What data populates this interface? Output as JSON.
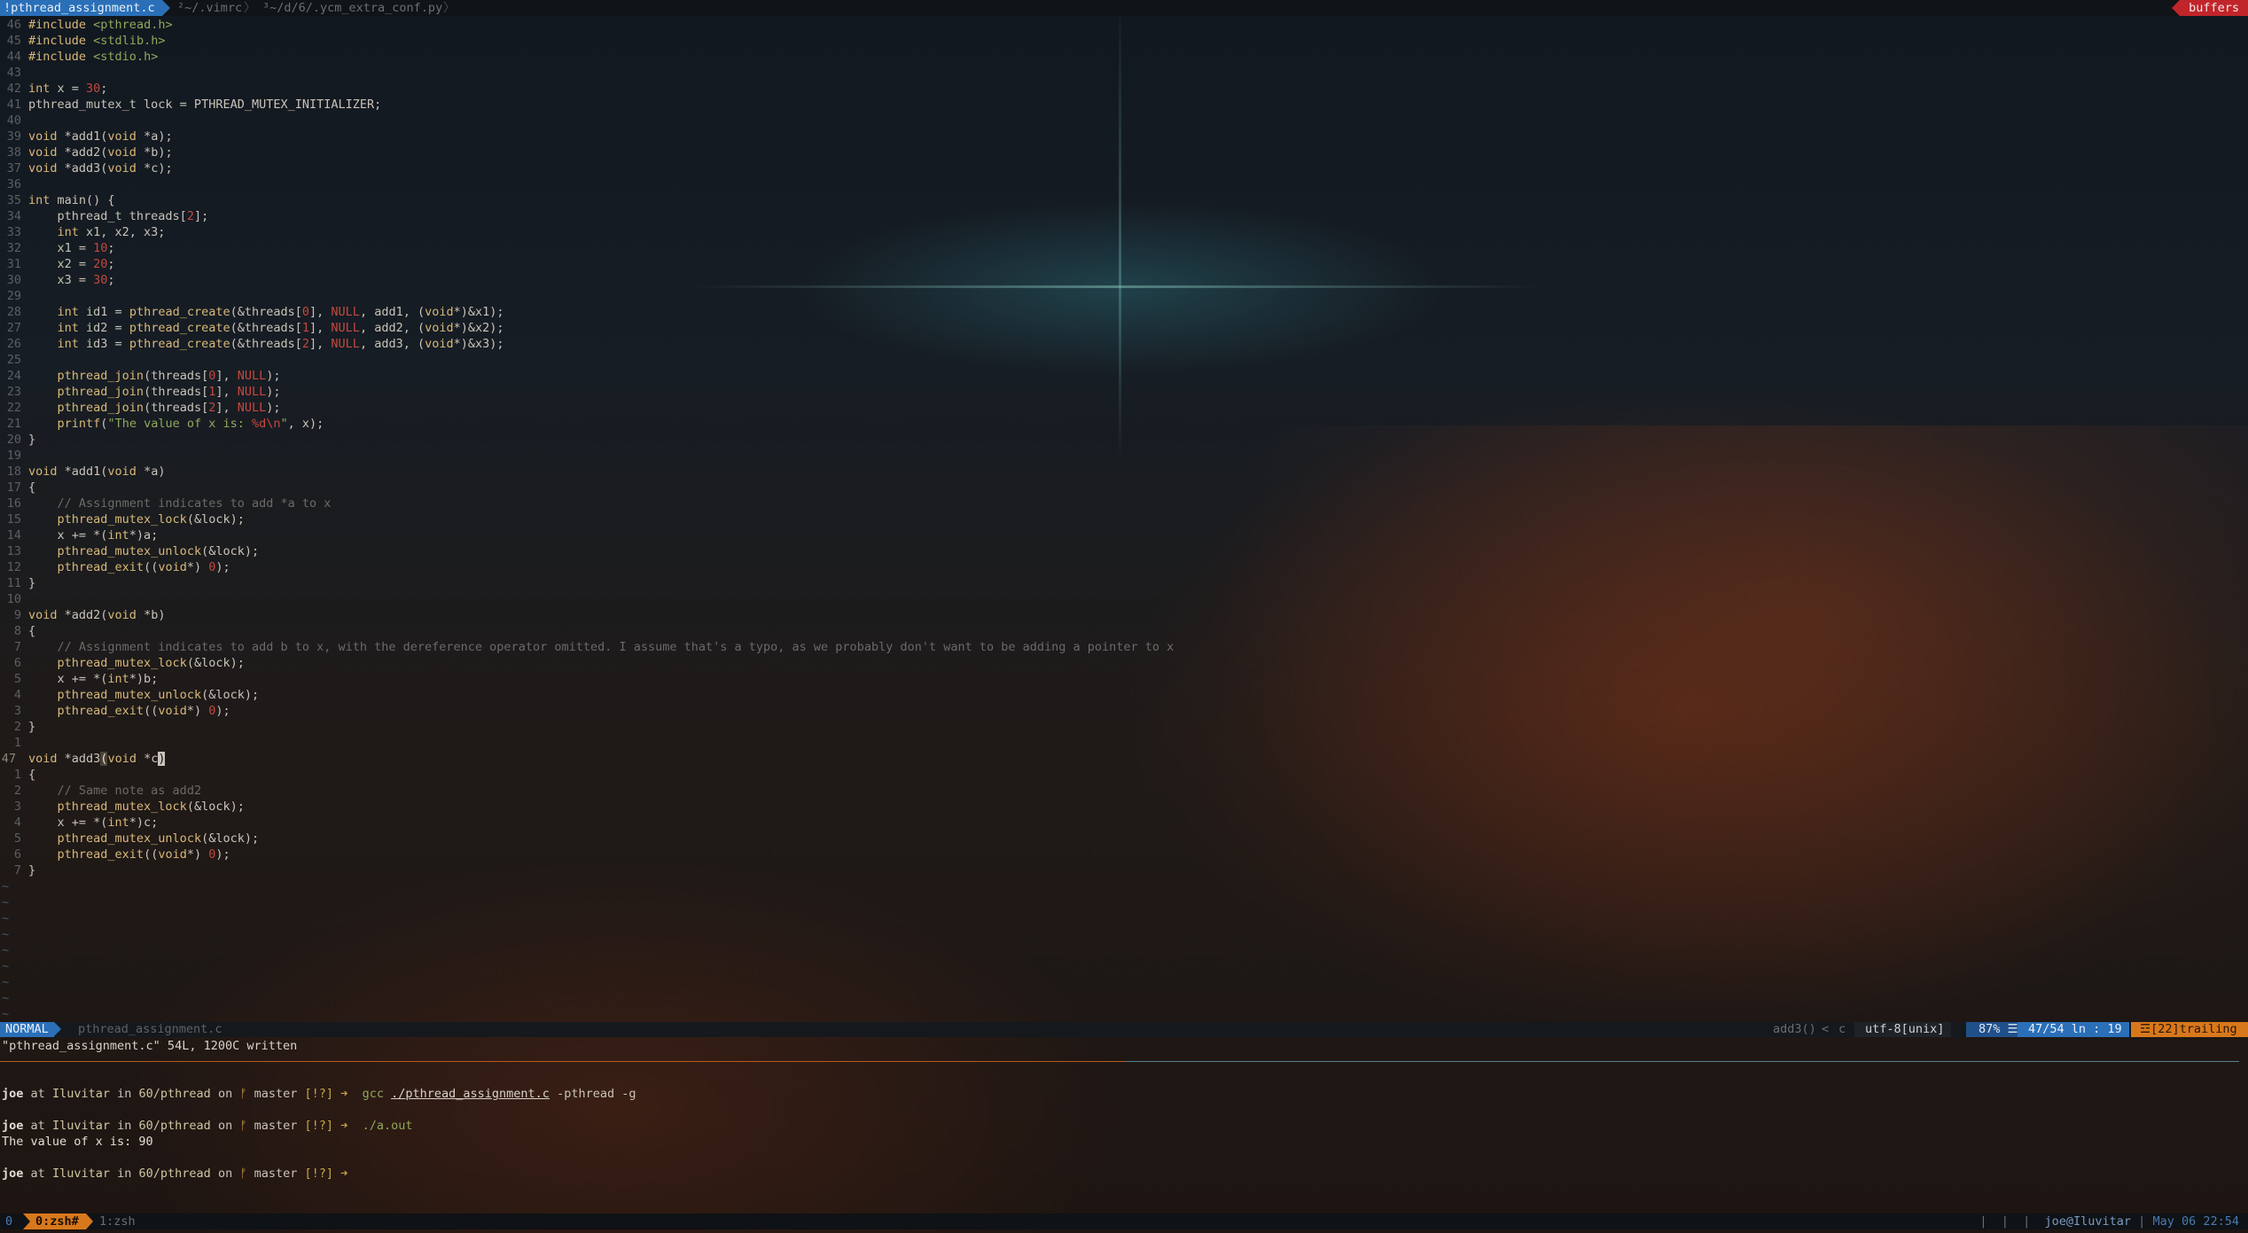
{
  "tabline": {
    "active_tab": "!pthread_assignment.c",
    "tabs": [
      "²~/.vimrc",
      "³~/d/6/.ycm_extra_conf.py"
    ],
    "separators": [
      "〉",
      "〉",
      "〉"
    ],
    "buffers_label": "buffers"
  },
  "editor": {
    "gutter": [
      "46",
      "45",
      "44",
      "43",
      "42",
      "41",
      "40",
      "39",
      "38",
      "37",
      "36",
      "35",
      "34",
      "33",
      "32",
      "31",
      "30",
      "29",
      "28",
      "27",
      "26",
      "25",
      "24",
      "23",
      "22",
      "21",
      "20",
      "19",
      "18",
      "17",
      "16",
      "15",
      "14",
      "13",
      "12",
      "11",
      "10",
      "9",
      "8",
      "7",
      "6",
      "5",
      "4",
      "3",
      "2",
      "1",
      "47",
      "1",
      "2",
      "3",
      "4",
      "5",
      "6",
      "7"
    ],
    "tilde_count": 9,
    "tilde_char": "~"
  },
  "statusline": {
    "mode": "NORMAL",
    "filename": "pthread_assignment.c",
    "function": "add3()",
    "chevron": "<",
    "filetype": "c",
    "encoding": "utf-8[unix]",
    "percent": "87%",
    "lines_icon": "☰",
    "position": "47/54 ln : 19",
    "trailing": "☲[22]trailing"
  },
  "message": "\"pthread_assignment.c\" 54L, 1200C written",
  "terminal": {
    "user": "joe",
    "at": "at",
    "host": "Iluvitar",
    "in": "in",
    "dir": "60/pthread",
    "on": "on",
    "branch_icon": "ᚠ",
    "branch": "master",
    "status": "[!?]",
    "arrow": "➜",
    "cmd1_prog": "gcc",
    "cmd1_file": "./pthread_assignment.c",
    "cmd1_flags": "-pthread -g",
    "cmd2": "./a.out",
    "output": "The value of x is: 90"
  },
  "tmux": {
    "session": "0",
    "active_window": "0:zsh#",
    "window": "1:zsh",
    "separators": "|  |  |",
    "user_host": "joe@Iluvitar",
    "bar": "|",
    "datetime": "May 06 22:54"
  }
}
